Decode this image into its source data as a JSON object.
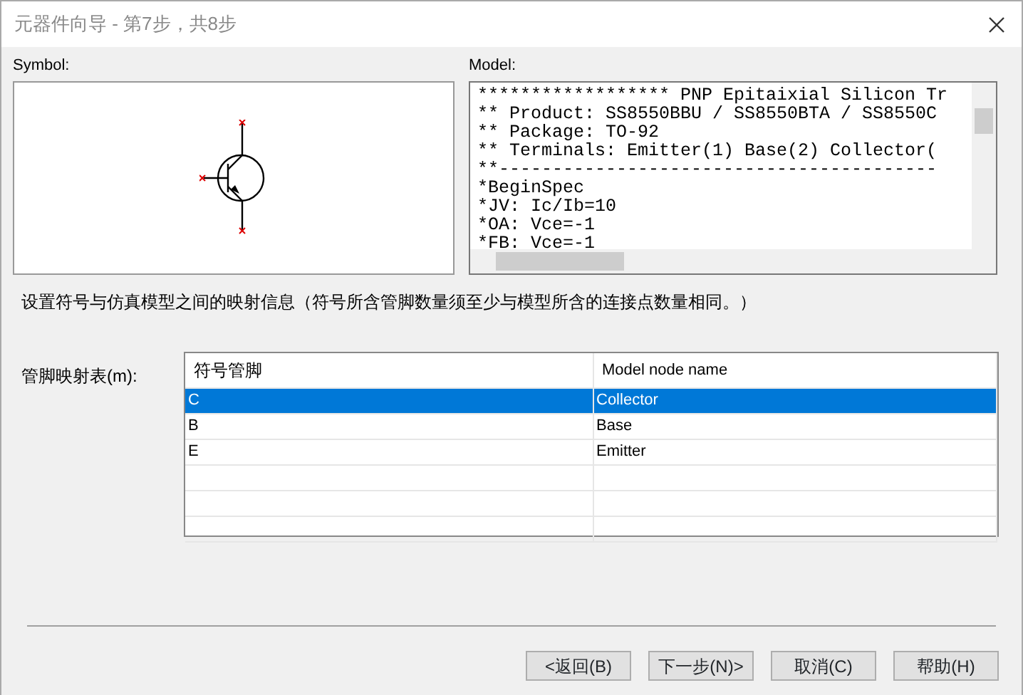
{
  "window": {
    "title": "元器件向导 - 第7步，共8步"
  },
  "symbol": {
    "label": "Symbol:"
  },
  "model": {
    "label": "Model:",
    "lines": [
      "****************** PNP Epitaixial Silicon Tr",
      "** Product: SS8550BBU / SS8550BTA / SS8550C",
      "** Package: TO-92",
      "** Terminals: Emitter(1) Base(2) Collector(",
      "**-----------------------------------------",
      "*BeginSpec",
      "*JV: Ic/Ib=10",
      "*OA: Vce=-1",
      "*FB: Vce=-1"
    ]
  },
  "description": "设置符号与仿真模型之间的映射信息（符号所含管脚数量须至少与模型所含的连接点数量相同。）",
  "mapping": {
    "label": "管脚映射表(m):",
    "columns": [
      "符号管脚",
      "Model node name"
    ],
    "rows": [
      {
        "cells": [
          "C",
          "Collector"
        ],
        "selected": true
      },
      {
        "cells": [
          "B",
          "Base"
        ],
        "selected": false
      },
      {
        "cells": [
          "E",
          "Emitter"
        ],
        "selected": false
      }
    ]
  },
  "buttons": [
    "<返回(B)",
    "下一步(N)>",
    "取消(C)",
    "帮助(H)"
  ]
}
